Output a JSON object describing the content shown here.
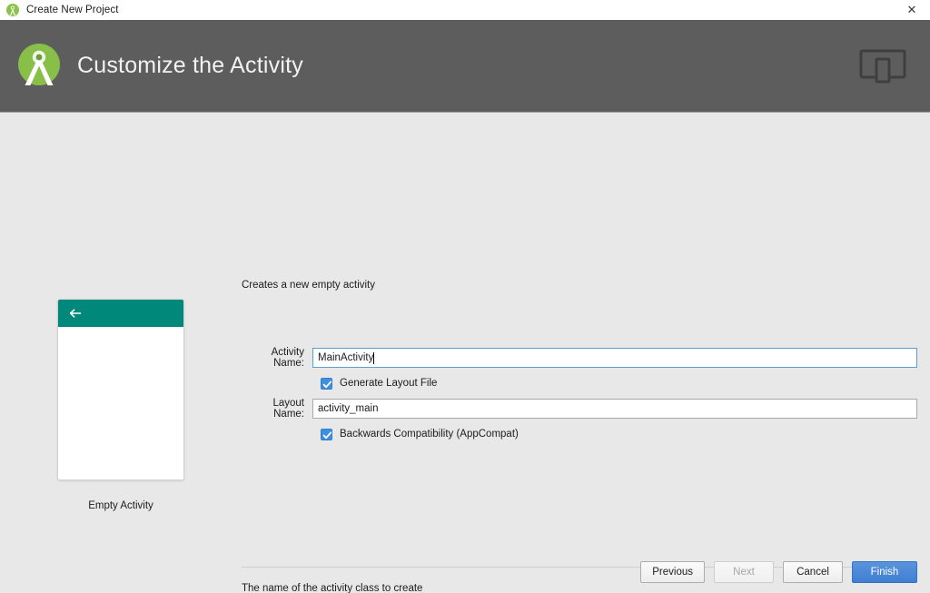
{
  "titlebar": {
    "title": "Create New Project",
    "app_icon": "android-studio-icon",
    "close_label": "✕"
  },
  "banner": {
    "heading": "Customize the Activity",
    "logo_icon": "android-studio-logo",
    "device_icon": "device-preview-icon",
    "background_color": "#5d5d5d"
  },
  "preview": {
    "template_name": "Empty Activity",
    "appbar_color": "#00897b",
    "back_icon": "arrow-left-icon"
  },
  "form": {
    "description": "Creates a new empty activity",
    "activity_name": {
      "label": "Activity Name:",
      "value": "MainActivity",
      "focused": true
    },
    "generate_layout": {
      "label": "Generate Layout File",
      "checked": true
    },
    "layout_name": {
      "label": "Layout Name:",
      "value": "activity_main",
      "focused": false
    },
    "backwards_compat": {
      "label": "Backwards Compatibility (AppCompat)",
      "checked": true
    },
    "help_text": "The name of the activity class to create"
  },
  "footer": {
    "previous": "Previous",
    "next": "Next",
    "cancel": "Cancel",
    "finish": "Finish",
    "primary_color": "#4a86d8"
  }
}
